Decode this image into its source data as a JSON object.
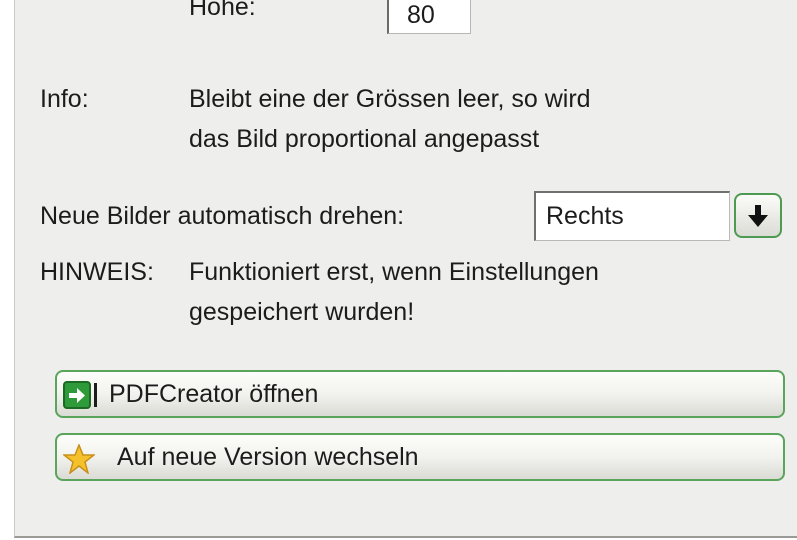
{
  "hoehe": {
    "label": "Höhe:",
    "value": "80"
  },
  "info": {
    "label": "Info:",
    "line1": "Bleibt eine der Grössen leer, so wird",
    "line2": "das Bild proportional angepasst"
  },
  "rotate": {
    "label": "Neue Bilder automatisch drehen:",
    "selected": "Rechts",
    "dropdown_icon": "arrow-down-icon"
  },
  "hinweis": {
    "label": "HINWEIS:",
    "line1": "Funktioniert erst, wenn Einstellungen",
    "line2": "gespeichert wurden!"
  },
  "buttons": {
    "open_pdfcreator": "PDFCreator öffnen",
    "open_pdfcreator_icon": "open-app-icon",
    "update_version": "Auf neue Version wechseln",
    "update_version_icon": "star-icon"
  },
  "colors": {
    "button_border": "#5aa45b",
    "panel_bg": "#eeeeec"
  }
}
